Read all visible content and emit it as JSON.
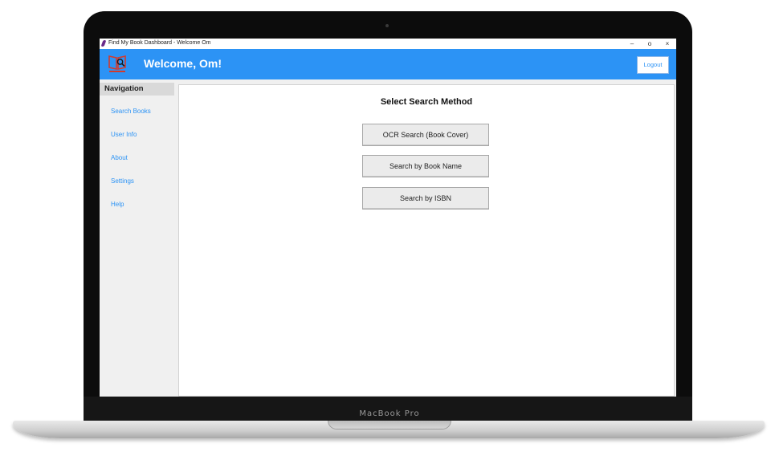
{
  "window": {
    "title": "Find My Book Dashboard - Welcome Om",
    "minimize": "–",
    "maximize": "o",
    "close": "×"
  },
  "header": {
    "welcome": "Welcome, Om!",
    "logout_label": "Logout",
    "accent_color": "#2c93f5"
  },
  "sidebar": {
    "heading": "Navigation",
    "items": [
      {
        "label": "Search Books"
      },
      {
        "label": "User Info"
      },
      {
        "label": "About"
      },
      {
        "label": "Settings"
      },
      {
        "label": "Help"
      }
    ]
  },
  "main": {
    "title": "Select Search Method",
    "buttons": [
      {
        "label": "OCR Search (Book Cover)"
      },
      {
        "label": "Search by Book Name"
      },
      {
        "label": "Search by ISBN"
      }
    ]
  },
  "device": {
    "model_label": "MacBook Pro"
  }
}
